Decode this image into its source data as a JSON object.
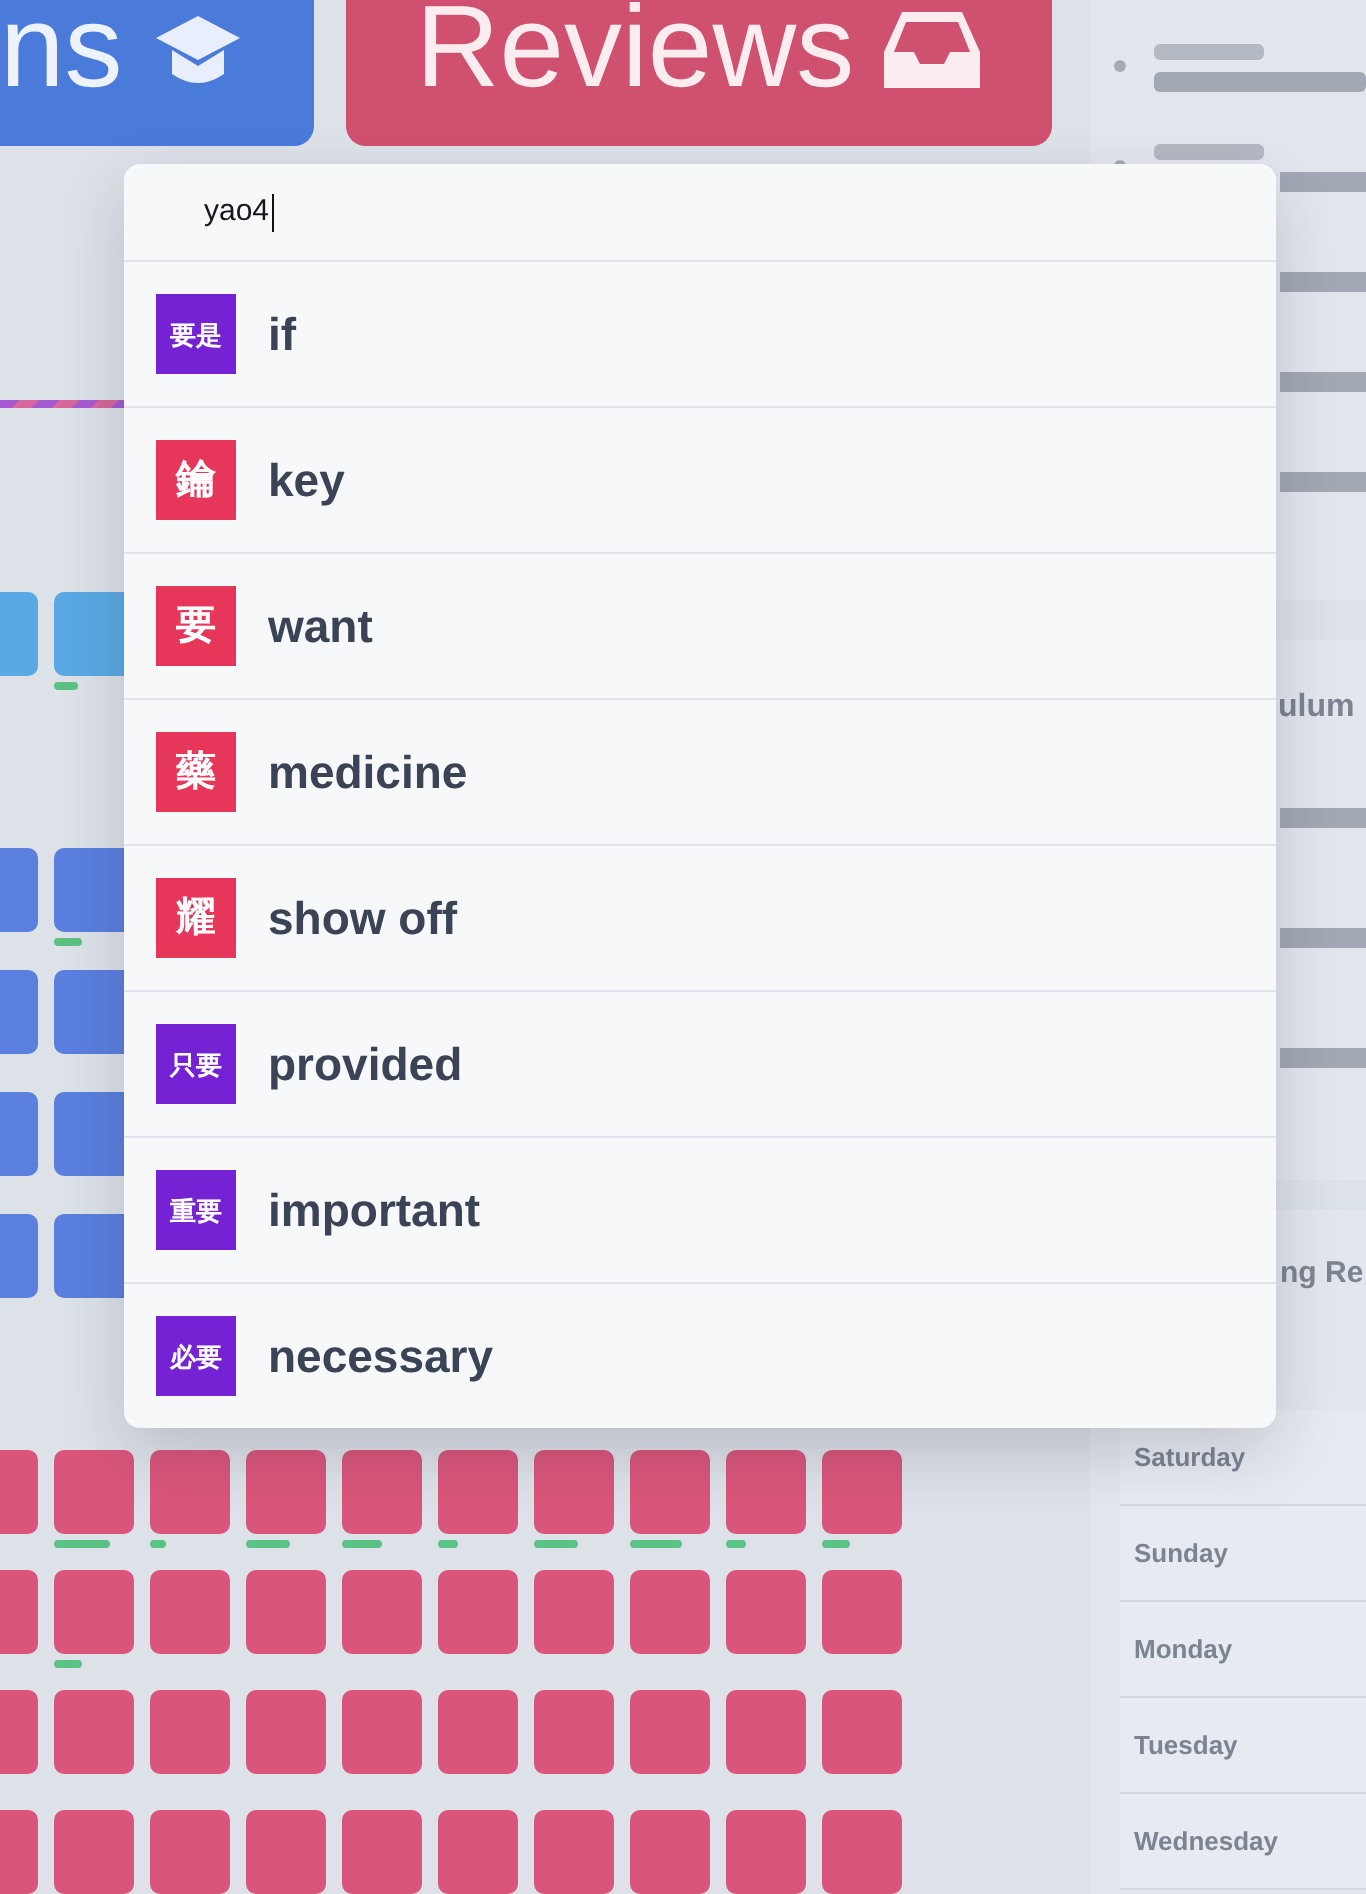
{
  "background": {
    "lessons_button": {
      "label": "ns"
    },
    "reviews_button": {
      "label": "Reviews"
    },
    "curriculum": {
      "heading": "ulum"
    },
    "schedule": {
      "heading": "ng Re",
      "days": [
        "Saturday",
        "Sunday",
        "Monday",
        "Tuesday",
        "Wednesday"
      ]
    }
  },
  "search": {
    "value": "yao4"
  },
  "results": [
    {
      "characters": "要是",
      "meaning": "if",
      "color": "#7422d4"
    },
    {
      "characters": "鑰",
      "meaning": "key",
      "color": "#e6365a"
    },
    {
      "characters": "要",
      "meaning": "want",
      "color": "#e6365a"
    },
    {
      "characters": "藥",
      "meaning": "medicine",
      "color": "#e6365a"
    },
    {
      "characters": "耀",
      "meaning": "show off",
      "color": "#e6365a"
    },
    {
      "characters": "只要",
      "meaning": "provided",
      "color": "#7422d4"
    },
    {
      "characters": "重要",
      "meaning": "important",
      "color": "#7422d4"
    },
    {
      "characters": "必要",
      "meaning": "necessary",
      "color": "#7422d4"
    }
  ]
}
